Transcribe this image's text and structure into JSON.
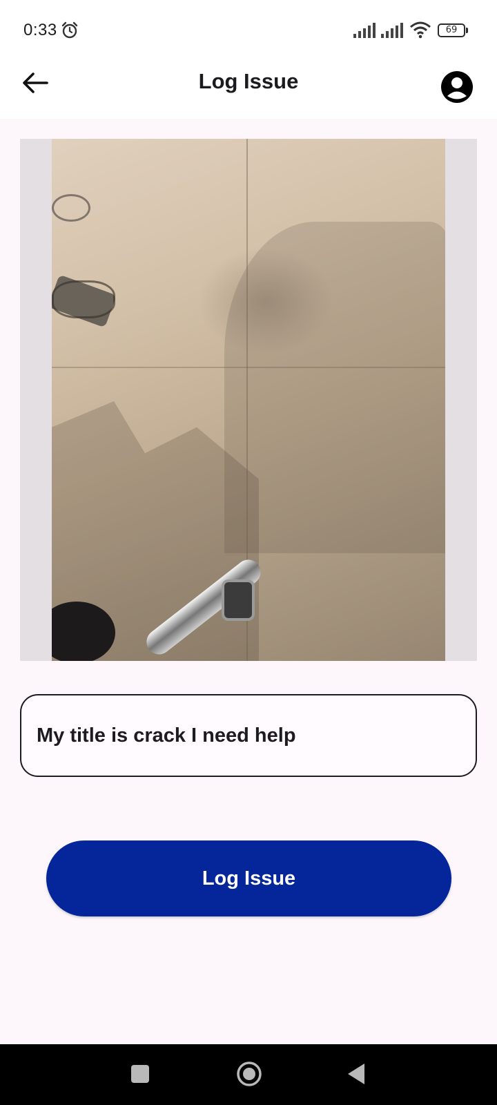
{
  "status_bar": {
    "time": "0:33",
    "battery_level": "69",
    "icons": [
      "alarm-icon",
      "signal-icon",
      "signal-icon",
      "wifi-icon",
      "battery-icon"
    ]
  },
  "app_bar": {
    "title": "Log Issue",
    "back_icon": "arrow-left-icon",
    "account_icon": "account-circle-icon"
  },
  "photo": {
    "description_icon": "photo-preview"
  },
  "form": {
    "title_value": "My title is crack I need help"
  },
  "actions": {
    "log_issue_label": "Log Issue"
  },
  "navigation": {
    "icons": [
      "recents-icon",
      "home-icon",
      "back-triangle-icon"
    ]
  },
  "colors": {
    "primary": "#05269a",
    "background": "#fdf7fc",
    "photo_frame": "#e3dfe3"
  }
}
